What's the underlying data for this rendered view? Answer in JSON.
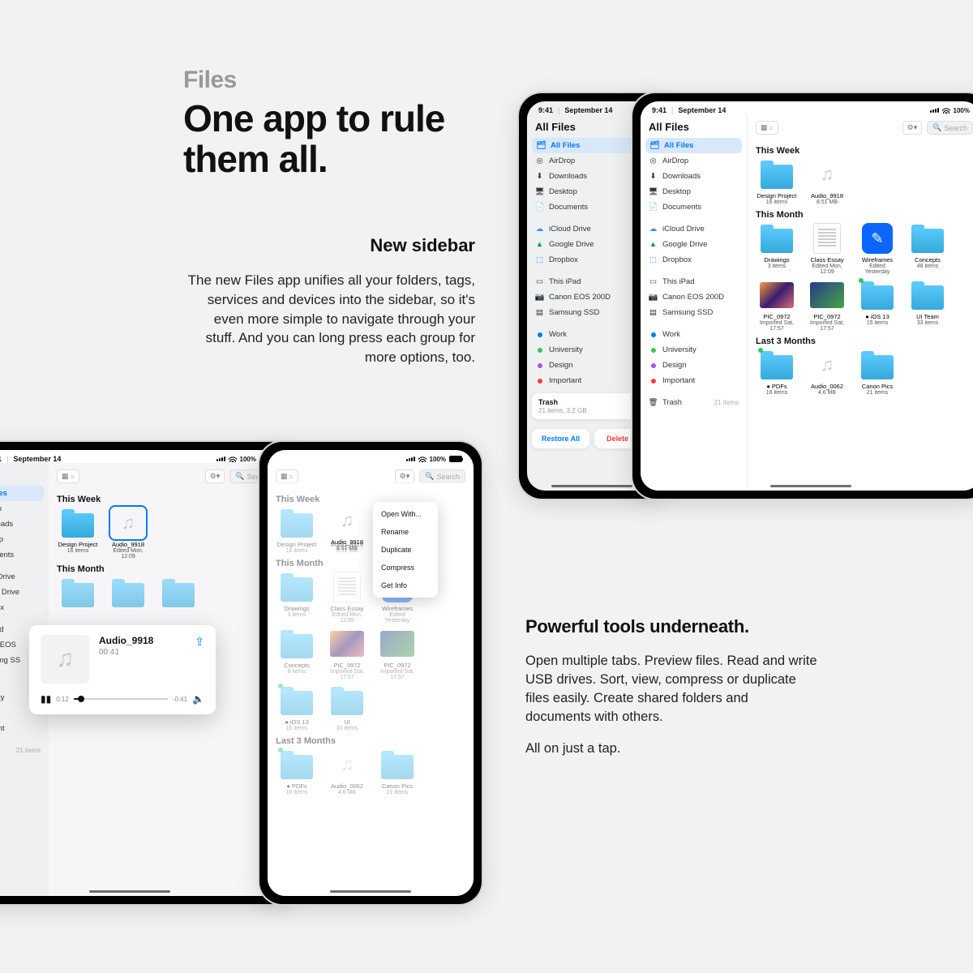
{
  "headline": {
    "eyebrow": "Files",
    "title": "One app to rule\nthem all."
  },
  "sub": {
    "title": "New sidebar",
    "body": "The new Files app unifies all your folders, tags, services and devices into the sidebar, so it's even more simple to navigate through your stuff. And you can long press each group for more options, too."
  },
  "tools": {
    "title": "Powerful tools underneath.",
    "body": "Open multiple tabs. Preview files. Read and write USB drives. Sort, view, compress or duplicate files easily. Create shared folders and documents with others.",
    "tag": "All on just a tap."
  },
  "status": {
    "time": "9:41",
    "date": "September 14",
    "batt": "100%"
  },
  "app_title": "All Files",
  "sidebar": {
    "locations": [
      {
        "icon": "folder-blue",
        "label": "All Files",
        "sel": true
      },
      {
        "icon": "airdrop",
        "label": "AirDrop"
      },
      {
        "icon": "download",
        "label": "Downloads"
      },
      {
        "icon": "desktop",
        "label": "Desktop"
      },
      {
        "icon": "doc",
        "label": "Documents"
      }
    ],
    "services": [
      {
        "icon": "icloud",
        "label": "iCloud Drive"
      },
      {
        "icon": "gdrive",
        "label": "Google Drive"
      },
      {
        "icon": "dropbox",
        "label": "Dropbox"
      }
    ],
    "devices": [
      {
        "icon": "ipad",
        "label": "This iPad"
      },
      {
        "icon": "camera",
        "label": "Canon EOS 200D"
      },
      {
        "icon": "ssd",
        "label": "Samsung SSD"
      }
    ],
    "tags": [
      {
        "color": "#007aff",
        "label": "Work"
      },
      {
        "color": "#34c759",
        "label": "University"
      },
      {
        "color": "#af52de",
        "label": "Design"
      },
      {
        "color": "#ff3b30",
        "label": "Important"
      }
    ],
    "trash": {
      "label": "Trash",
      "meta": "21 items",
      "detail": "21 items, 3.2 GB"
    },
    "restore": "Restore All",
    "delete": "Delete All"
  },
  "toolbar": {
    "search": "Search"
  },
  "sections": {
    "week": {
      "label": "This Week",
      "items": [
        {
          "name": "Design Project",
          "sub": "16 items",
          "type": "folder-people"
        },
        {
          "name": "Audio_9918",
          "sub": "8.51 MB",
          "type": "audio",
          "sub2": "Edited Mon, 12:09"
        }
      ]
    },
    "month": {
      "label": "This Month",
      "items": [
        {
          "name": "Drawings",
          "sub": "3 items",
          "type": "folder"
        },
        {
          "name": "Class Essay",
          "sub": "Edited Mon, 12:09",
          "type": "doc"
        },
        {
          "name": "Wireframes",
          "sub": "Edited Yesterday",
          "type": "app"
        },
        {
          "name": "Concepts",
          "sub": "48 items",
          "type": "folder",
          "sub_alt": "8 items"
        },
        {
          "name": "PIC_0972",
          "sub": "Imported Sat, 17:57",
          "type": "photo"
        },
        {
          "name": "PIC_0972",
          "sub": "Imported Sat, 17:57",
          "type": "photo-b"
        },
        {
          "name": "iOS 13",
          "sub": "15 items",
          "type": "folder",
          "badge": true,
          "prefix": "● "
        },
        {
          "name": "UI Team",
          "sub": "33 items",
          "type": "folder-people",
          "alt": "UI"
        }
      ]
    },
    "last3": {
      "label": "Last 3 Months",
      "items": [
        {
          "name": "PDFs",
          "sub": "16 items",
          "type": "folder",
          "badge": true,
          "prefix": "● "
        },
        {
          "name": "Audio_0062",
          "sub": "4.6 MB",
          "type": "audio"
        },
        {
          "name": "Canon Pics",
          "sub": "21 items",
          "type": "folder"
        }
      ]
    }
  },
  "context_menu": [
    "Open With...",
    "Rename",
    "Duplicate",
    "Compress",
    "Get Info"
  ],
  "audio_preview": {
    "title": "Audio_9918",
    "elapsed": "00:41",
    "start": "0:12",
    "end": "-0:41"
  }
}
